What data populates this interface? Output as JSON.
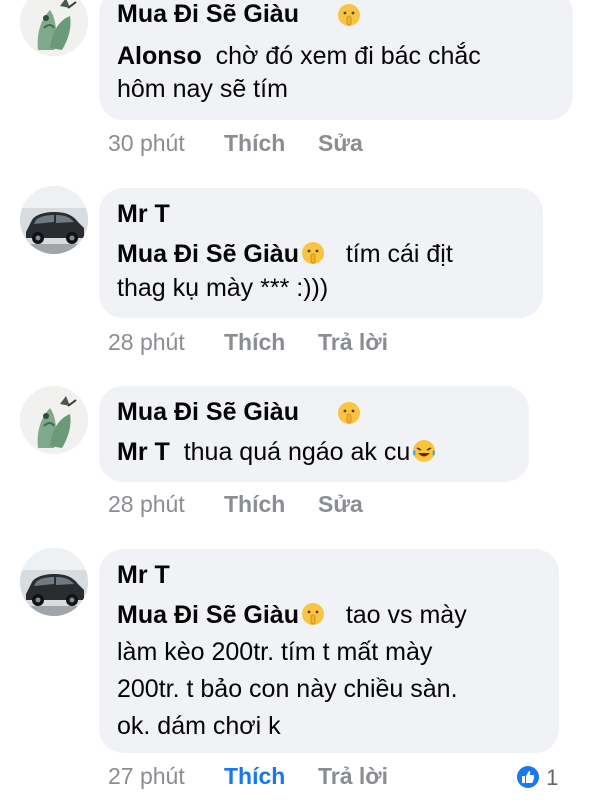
{
  "comments": [
    {
      "author": "Mua Đi Sẽ Giàu",
      "mention": "Alonso",
      "lines": [
        "chờ đó xem đi bác chắc",
        "hôm nay sẽ tím"
      ],
      "time": "30 phút",
      "like": "Thích",
      "action2": "Sửa",
      "avatar": "plant-art-avatar"
    },
    {
      "author": "Mr T",
      "mention": "Mua Đi Sẽ Giàu",
      "lines": [
        "tím cái địt",
        "thag kụ mày *** :)))"
      ],
      "time": "28 phút",
      "like": "Thích",
      "action2": "Trả lời",
      "avatar": "car-avatar"
    },
    {
      "author": "Mua Đi Sẽ Giàu",
      "mention": "Mr T",
      "lines": [
        "thua quá ngáo ak cu"
      ],
      "time": "28 phút",
      "like": "Thích",
      "action2": "Sửa",
      "avatar": "plant-art-avatar"
    },
    {
      "author": "Mr T",
      "mention": "Mua Đi Sẽ Giàu",
      "lines": [
        "tao vs mày",
        "làm kèo 200tr. tím t mất mày",
        "200tr. t bảo con này chiều sàn.",
        "ok. dám chơi k"
      ],
      "time": "27 phút",
      "like": "Thích",
      "action2": "Trả lời",
      "avatar": "car-avatar",
      "reaction_count": "1"
    }
  ],
  "colors": {
    "bubble": "#f0f2f5",
    "meta": "#8a8d91",
    "like_active": "#1877f2"
  }
}
